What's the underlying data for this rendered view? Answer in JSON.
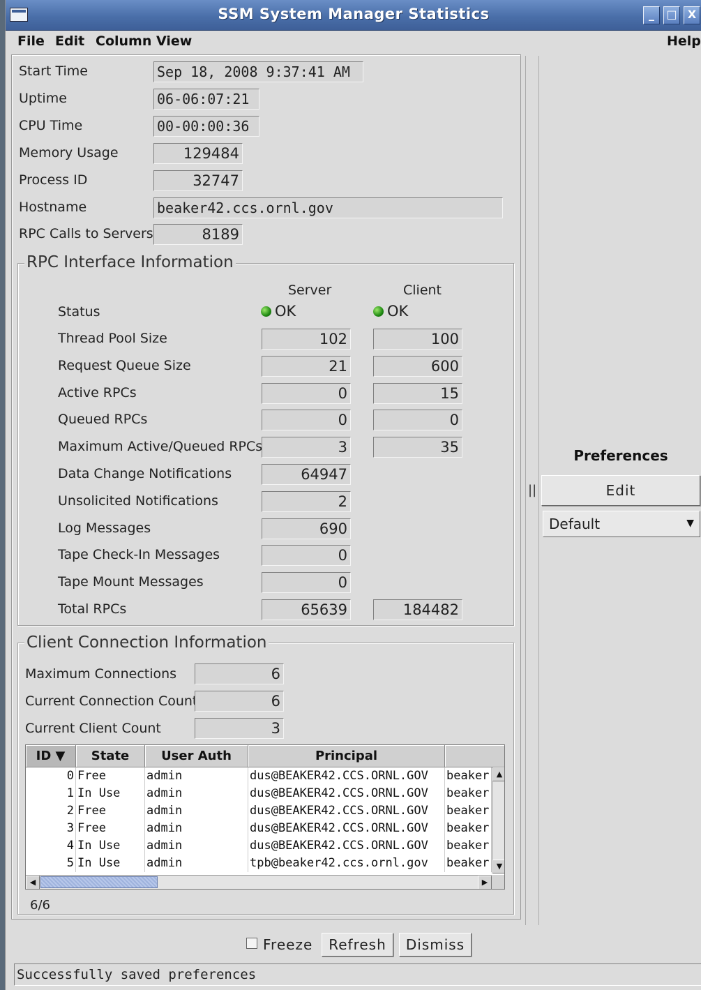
{
  "window": {
    "title": "SSM System Manager Statistics",
    "controls": {
      "minimize": "_",
      "maximize": "□",
      "close": "X"
    }
  },
  "menu": {
    "file": "File",
    "edit": "Edit",
    "column_view": "Column View",
    "help": "Help"
  },
  "general": {
    "start_time": {
      "label": "Start Time",
      "value": "Sep 18, 2008 9:37:41 AM"
    },
    "uptime": {
      "label": "Uptime",
      "value": "06-06:07:21"
    },
    "cpu_time": {
      "label": "CPU Time",
      "value": "00-00:00:36"
    },
    "memory_usage": {
      "label": "Memory Usage",
      "value": "129484"
    },
    "process_id": {
      "label": "Process ID",
      "value": "32747"
    },
    "hostname": {
      "label": "Hostname",
      "value": "beaker42.ccs.ornl.gov"
    },
    "rpc_calls": {
      "label": "RPC Calls to Servers",
      "value": "8189"
    }
  },
  "rpc": {
    "title": "RPC Interface Information",
    "col_server": "Server",
    "col_client": "Client",
    "status": {
      "label": "Status",
      "server": "OK",
      "client": "OK"
    },
    "rows": [
      {
        "label": "Thread Pool Size",
        "server": "102",
        "client": "100"
      },
      {
        "label": "Request Queue Size",
        "server": "21",
        "client": "600"
      },
      {
        "label": "Active RPCs",
        "server": "0",
        "client": "15"
      },
      {
        "label": "Queued RPCs",
        "server": "0",
        "client": "0"
      },
      {
        "label": "Maximum Active/Queued RPCs",
        "server": "3",
        "client": "35"
      },
      {
        "label": "Data Change Notifications",
        "server": "64947"
      },
      {
        "label": "Unsolicited Notifications",
        "server": "2"
      },
      {
        "label": "Log Messages",
        "server": "690"
      },
      {
        "label": "Tape Check-In Messages",
        "server": "0"
      },
      {
        "label": "Tape Mount Messages",
        "server": "0"
      },
      {
        "label": "Total RPCs",
        "server": "65639",
        "client": "184482"
      }
    ]
  },
  "clients": {
    "title": "Client Connection Information",
    "max_connections": {
      "label": "Maximum Connections",
      "value": "6"
    },
    "current_connections": {
      "label": "Current Connection Count",
      "value": "6"
    },
    "current_clients": {
      "label": "Current Client Count",
      "value": "3"
    },
    "columns": [
      "ID ▼",
      "State",
      "User Auth",
      "Principal",
      ""
    ],
    "rows": [
      {
        "id": "0",
        "state": "Free",
        "auth": "admin",
        "principal": "dus@BEAKER42.CCS.ORNL.GOV",
        "host": "beaker"
      },
      {
        "id": "1",
        "state": "In Use",
        "auth": "admin",
        "principal": "dus@BEAKER42.CCS.ORNL.GOV",
        "host": "beaker"
      },
      {
        "id": "2",
        "state": "Free",
        "auth": "admin",
        "principal": "dus@BEAKER42.CCS.ORNL.GOV",
        "host": "beaker"
      },
      {
        "id": "3",
        "state": "Free",
        "auth": "admin",
        "principal": "dus@BEAKER42.CCS.ORNL.GOV",
        "host": "beaker"
      },
      {
        "id": "4",
        "state": "In Use",
        "auth": "admin",
        "principal": "dus@BEAKER42.CCS.ORNL.GOV",
        "host": "beaker"
      },
      {
        "id": "5",
        "state": "In Use",
        "auth": "admin",
        "principal": "tpb@beaker42.ccs.ornl.gov",
        "host": "beaker"
      }
    ],
    "row_count": "6/6"
  },
  "preferences": {
    "title": "Preferences",
    "edit": "Edit",
    "selected": "Default"
  },
  "splitter": "||",
  "buttons": {
    "freeze": "Freeze",
    "refresh": "Refresh",
    "dismiss": "Dismiss"
  },
  "status": "Successfully saved preferences"
}
